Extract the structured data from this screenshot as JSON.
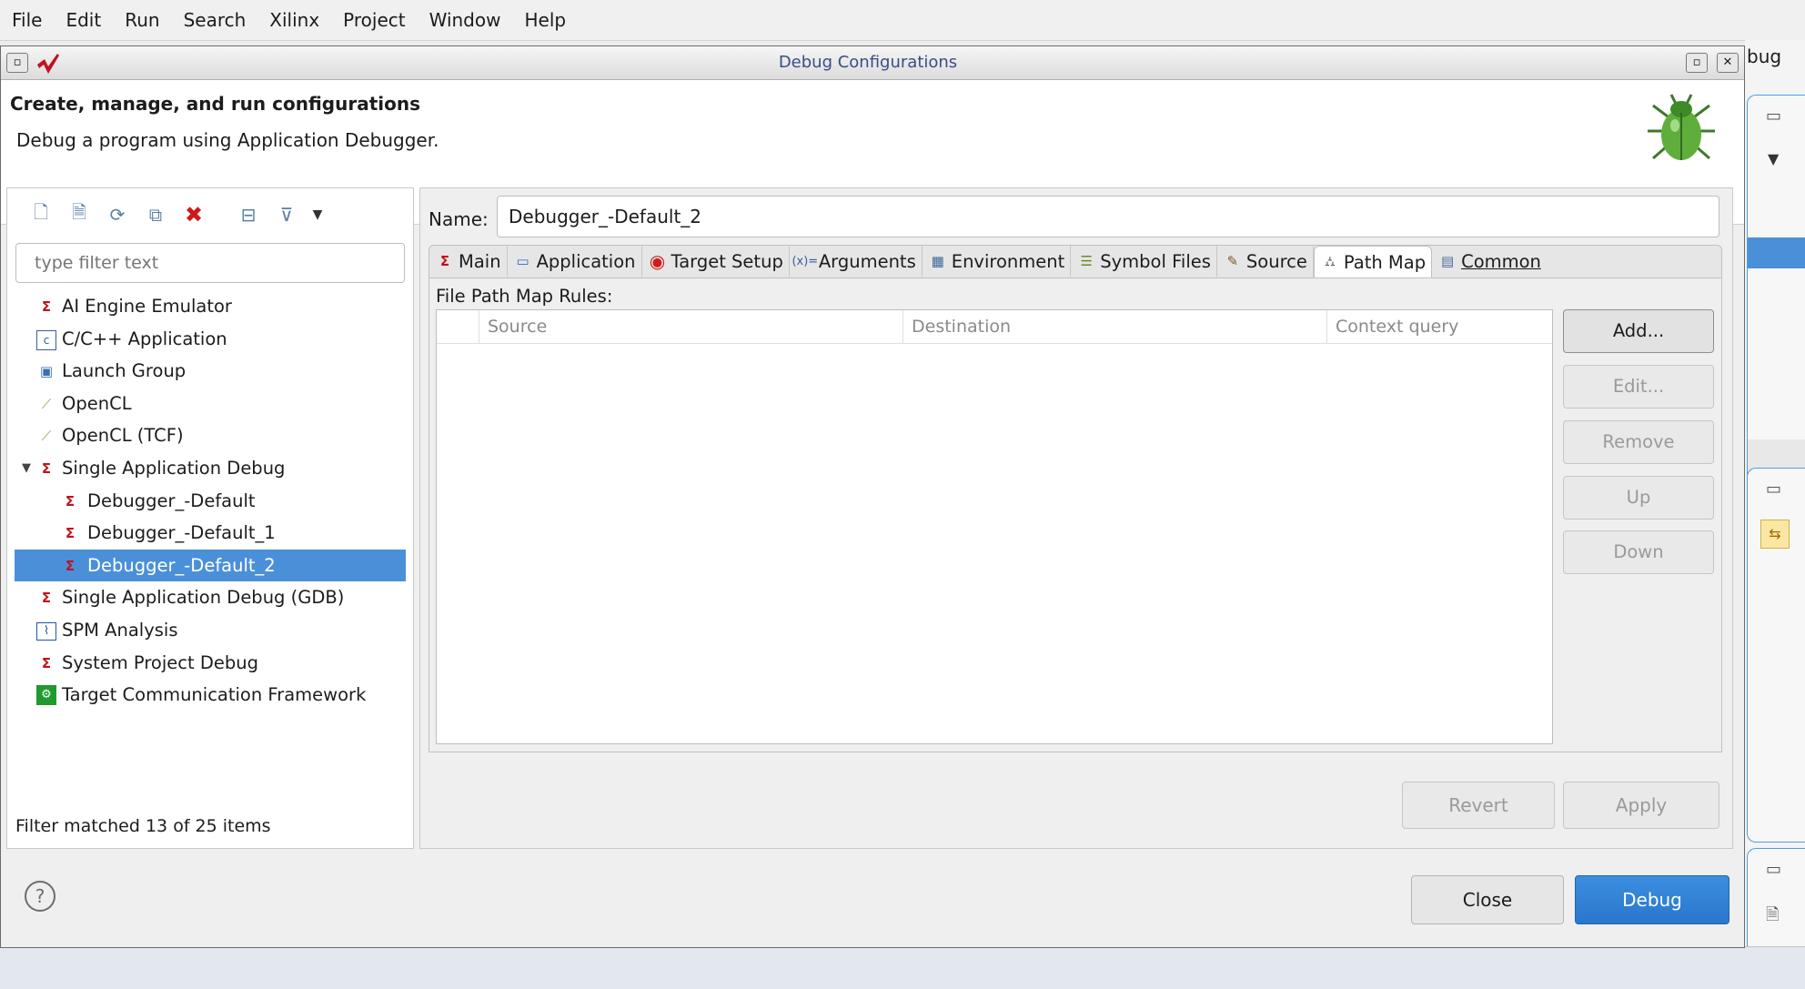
{
  "menubar": [
    "File",
    "Edit",
    "Run",
    "Search",
    "Xilinx",
    "Project",
    "Window",
    "Help"
  ],
  "background": {
    "tab_fragment": "bug"
  },
  "window": {
    "title": "Debug Configurations"
  },
  "header": {
    "title": "Create, manage, and run configurations",
    "description": "Debug a program using Application Debugger."
  },
  "toolbar_icons": [
    "new-config-icon",
    "new-prototype-icon",
    "export-icon",
    "duplicate-icon",
    "delete-icon",
    "collapse-all-icon",
    "filter-icon",
    "menu-chevron-icon"
  ],
  "filter": {
    "placeholder": "type filter text"
  },
  "tree": [
    {
      "label": "AI Engine Emulator",
      "icon": "xilinx-tcf-icon",
      "level": 0
    },
    {
      "label": "C/C++ Application",
      "icon": "c-app-icon",
      "level": 0
    },
    {
      "label": "Launch Group",
      "icon": "launch-group-icon",
      "level": 0
    },
    {
      "label": "OpenCL",
      "icon": "opencl-icon",
      "level": 0
    },
    {
      "label": "OpenCL (TCF)",
      "icon": "opencl-icon",
      "level": 0
    },
    {
      "label": "Single Application Debug",
      "icon": "xilinx-tcf-icon",
      "level": 0,
      "expanded": true
    },
    {
      "label": "Debugger_-Default",
      "icon": "xilinx-tcf-icon",
      "level": 1
    },
    {
      "label": "Debugger_-Default_1",
      "icon": "xilinx-tcf-icon",
      "level": 1
    },
    {
      "label": "Debugger_-Default_2",
      "icon": "xilinx-tcf-icon",
      "level": 1,
      "selected": true
    },
    {
      "label": "Single Application Debug (GDB)",
      "icon": "xilinx-gdb-icon",
      "level": 0
    },
    {
      "label": "SPM Analysis",
      "icon": "spm-chart-icon",
      "level": 0
    },
    {
      "label": "System Project Debug",
      "icon": "xilinx-tcf-icon",
      "level": 0
    },
    {
      "label": "Target Communication Framework",
      "icon": "tcf-icon",
      "level": 0
    }
  ],
  "filter_status": "Filter matched 13 of 25 items",
  "config": {
    "name_label": "Name:",
    "name_value": "Debugger_-Default_2"
  },
  "tabs": [
    {
      "label": "Main",
      "icon": "xilinx-icon"
    },
    {
      "label": "Application",
      "icon": "window-icon"
    },
    {
      "label": "Target Setup",
      "icon": "target-icon"
    },
    {
      "label": "Arguments",
      "icon": "arguments-icon"
    },
    {
      "label": "Environment",
      "icon": "environment-icon"
    },
    {
      "label": "Symbol Files",
      "icon": "symbol-files-icon"
    },
    {
      "label": "Source",
      "icon": "source-icon"
    },
    {
      "label": "Path Map",
      "icon": "path-map-icon",
      "active": true
    },
    {
      "label": "Common",
      "icon": "common-icon"
    }
  ],
  "pathmap": {
    "section_label": "File Path Map Rules:",
    "columns": [
      "Source",
      "Destination",
      "Context query"
    ],
    "buttons": [
      {
        "label": "Add...",
        "enabled": true
      },
      {
        "label": "Edit...",
        "enabled": false
      },
      {
        "label": "Remove",
        "enabled": false
      },
      {
        "label": "Up",
        "enabled": false
      },
      {
        "label": "Down",
        "enabled": false
      }
    ]
  },
  "actions": {
    "revert": "Revert",
    "apply": "Apply",
    "close": "Close",
    "debug": "Debug"
  },
  "colors": {
    "selection": "#4a90d9",
    "primary_button": "#2f7fd4",
    "title_text": "#3a4d86",
    "delete_red": "#d01818"
  }
}
